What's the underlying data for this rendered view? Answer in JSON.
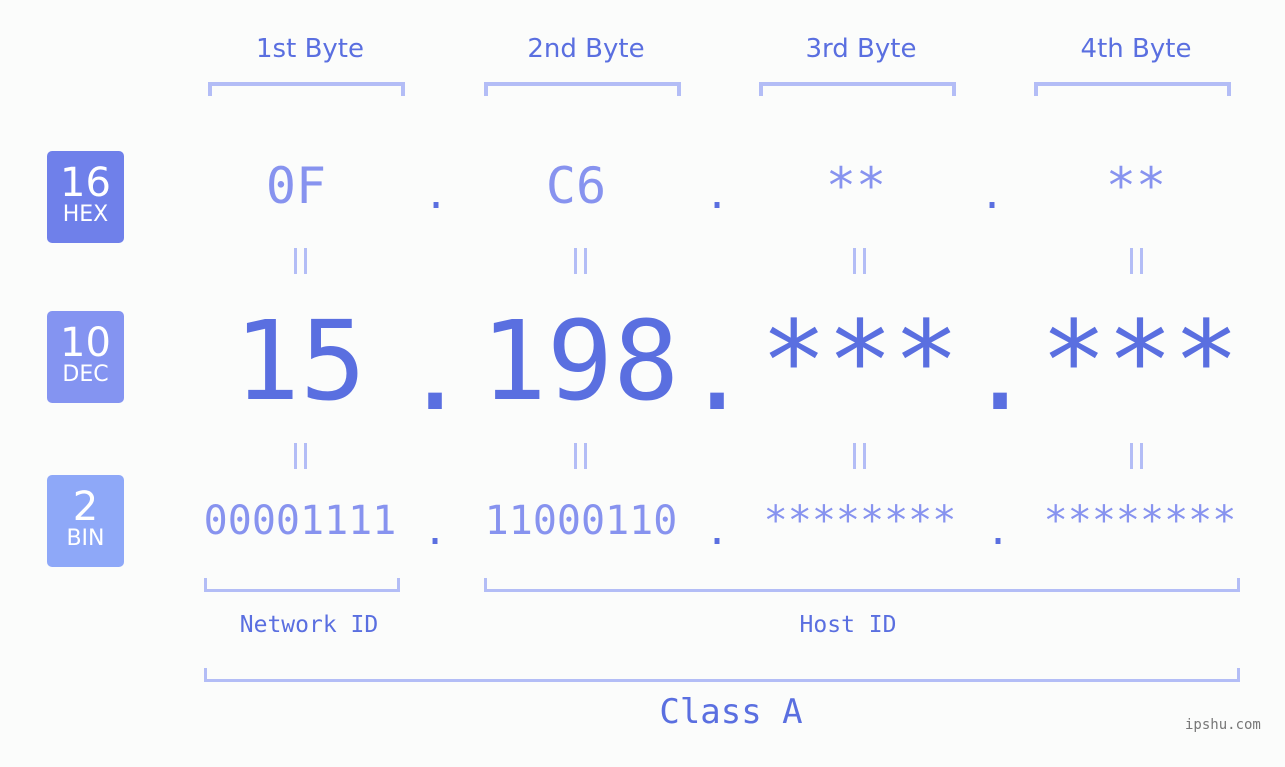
{
  "byte_headers": [
    "1st Byte",
    "2nd Byte",
    "3rd Byte",
    "4th Byte"
  ],
  "rows": {
    "hex": {
      "base": "16",
      "label": "HEX",
      "color": "#6f80ea",
      "values": [
        "0F",
        "C6",
        "**",
        "**"
      ]
    },
    "dec": {
      "base": "10",
      "label": "DEC",
      "color": "#8494f1",
      "values": [
        "15",
        "198",
        "***",
        "***"
      ]
    },
    "bin": {
      "base": "2",
      "label": "BIN",
      "color": "#8ea8f8",
      "values": [
        "00001111",
        "11000110",
        "********",
        "********"
      ]
    }
  },
  "separator": ".",
  "network_id_label": "Network ID",
  "host_id_label": "Host ID",
  "class_label": "Class A",
  "watermark": "ipshu.com",
  "colors": {
    "accent": "#5a6fe0",
    "light": "#8793ef",
    "bracket": "#b3bdf6"
  }
}
